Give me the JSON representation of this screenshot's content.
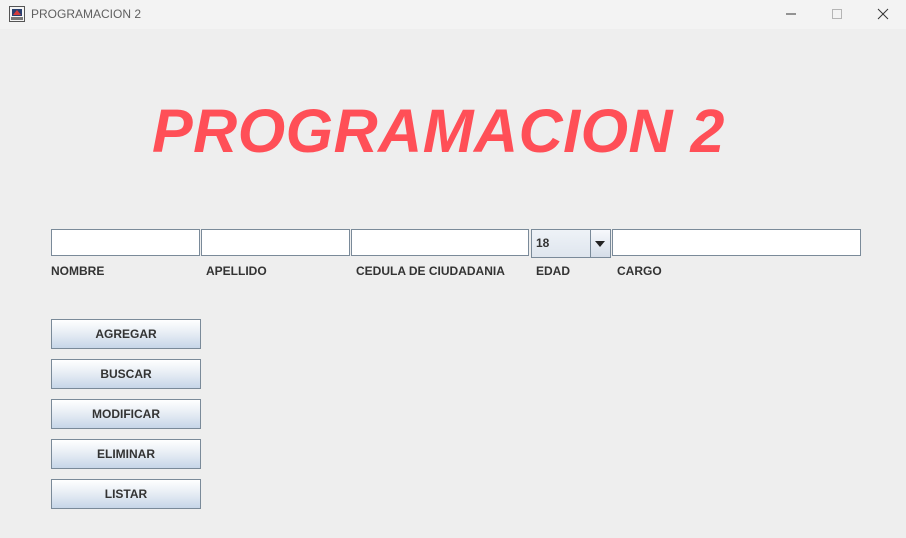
{
  "window": {
    "title": "PROGRAMACION 2",
    "controls": {
      "minimize_icon": "minimize-icon",
      "maximize_icon": "maximize-icon",
      "close_icon": "close-icon"
    }
  },
  "header": {
    "title": "PROGRAMACION 2",
    "title_color": "#ff4f57"
  },
  "form": {
    "nombre": {
      "label": "NOMBRE",
      "value": ""
    },
    "apellido": {
      "label": "APELLIDO",
      "value": ""
    },
    "cedula": {
      "label": "CEDULA DE CIUDADANIA",
      "value": ""
    },
    "edad": {
      "label": "EDAD",
      "selected": "18"
    },
    "cargo": {
      "label": "CARGO",
      "value": ""
    }
  },
  "buttons": {
    "agregar": "AGREGAR",
    "buscar": "BUSCAR",
    "modificar": "MODIFICAR",
    "eliminar": "ELIMINAR",
    "listar": "LISTAR"
  }
}
